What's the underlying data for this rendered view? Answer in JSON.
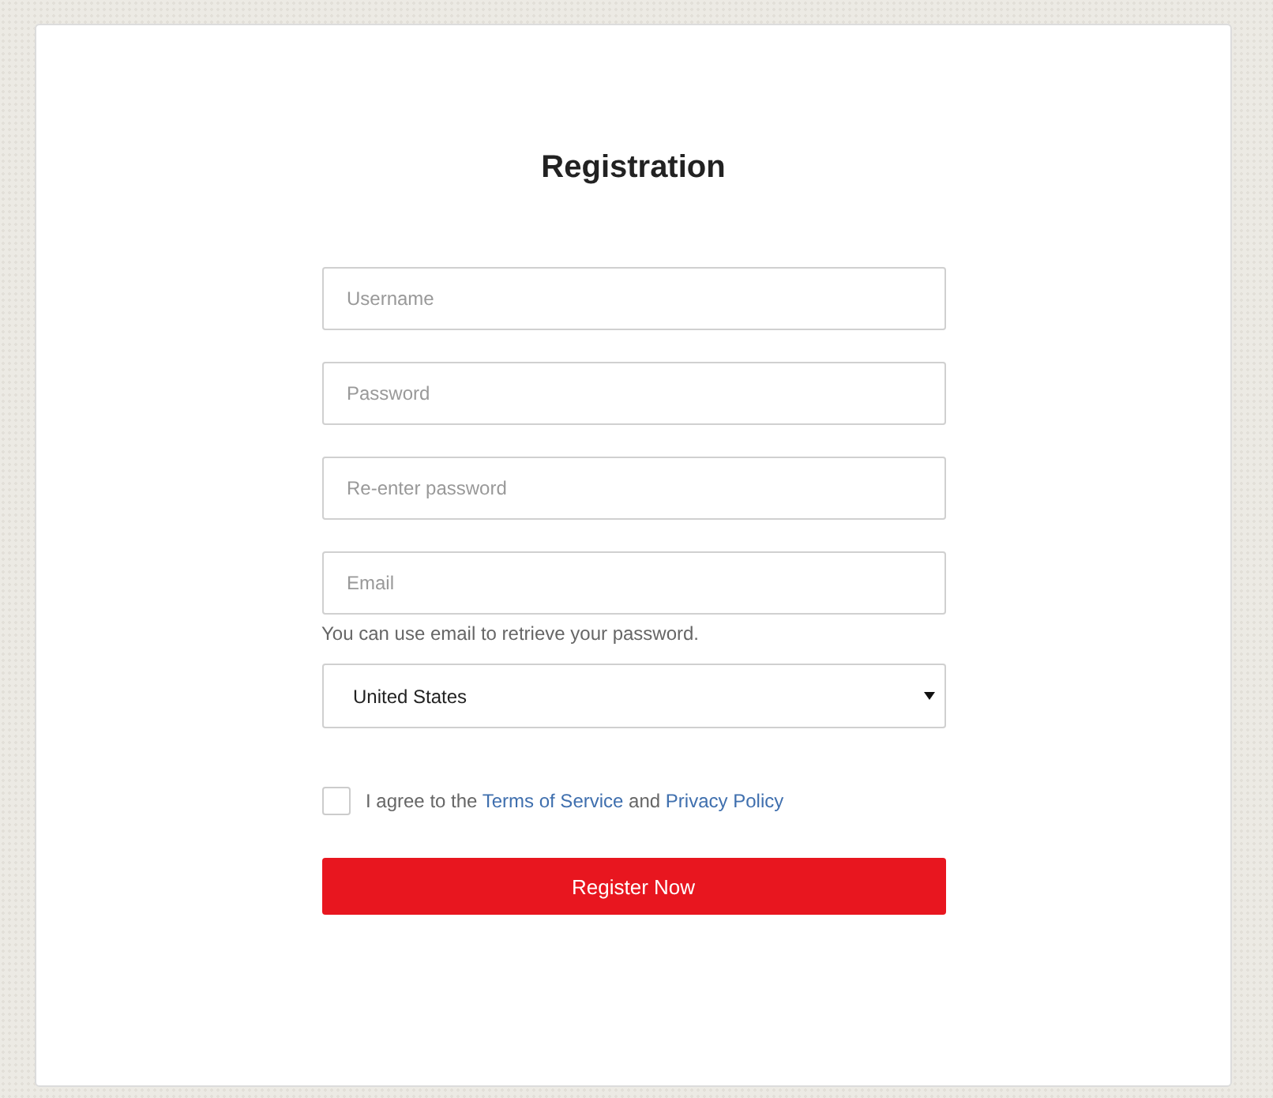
{
  "title": "Registration",
  "fields": [
    {
      "placeholder": "Username"
    },
    {
      "placeholder": "Password"
    },
    {
      "placeholder": "Re-enter password"
    },
    {
      "placeholder": "Email",
      "hint": "You can use email to retrieve your password."
    }
  ],
  "country": {
    "value": "United States"
  },
  "agreement": {
    "checked": false,
    "prefix": "I agree to the",
    "terms_link": "Terms of Service",
    "middle": "and",
    "privacy_link": "Privacy Policy"
  },
  "submit": {
    "label": "Register Now"
  }
}
